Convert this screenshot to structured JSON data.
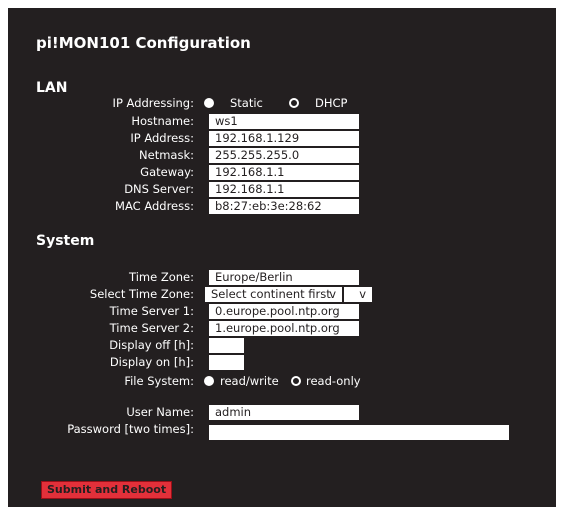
{
  "title": "pi!MON101 Configuration",
  "lan": {
    "heading": "LAN",
    "ip_addressing_label": "IP Addressing:",
    "static_label": "Static",
    "dhcp_label": "DHCP",
    "hostname_label": "Hostname:",
    "hostname": "ws1",
    "ip_label": "IP Address:",
    "ip": "192.168.1.129",
    "netmask_label": "Netmask:",
    "netmask": "255.255.255.0",
    "gateway_label": "Gateway:",
    "gateway": "192.168.1.1",
    "dns_label": "DNS Server:",
    "dns": "192.168.1.1",
    "mac_label": "MAC Address:",
    "mac": "b8:27:eb:3e:28:62"
  },
  "system": {
    "heading": "System",
    "timezone_label": "Time Zone:",
    "timezone": "Europe/Berlin",
    "select_tz_label": "Select Time Zone:",
    "continent_select": "Select continent first",
    "select_arrow": "v",
    "ts1_label": "Time Server 1:",
    "ts1": "0.europe.pool.ntp.org",
    "ts2_label": "Time Server 2:",
    "ts2": "1.europe.pool.ntp.org",
    "display_off_label": "Display off [h]:",
    "display_off": "",
    "display_on_label": "Display on [h]:",
    "display_on": "",
    "fs_label": "File System:",
    "rw_label": "read/write",
    "ro_label": "read-only",
    "user_label": "User Name:",
    "user": "admin",
    "pw_label": "Password [two times]:"
  },
  "submit_label": "Submit and Reboot",
  "colors": {
    "background": "#231f20",
    "submit": "#e2303a",
    "text": "#ffffff"
  }
}
